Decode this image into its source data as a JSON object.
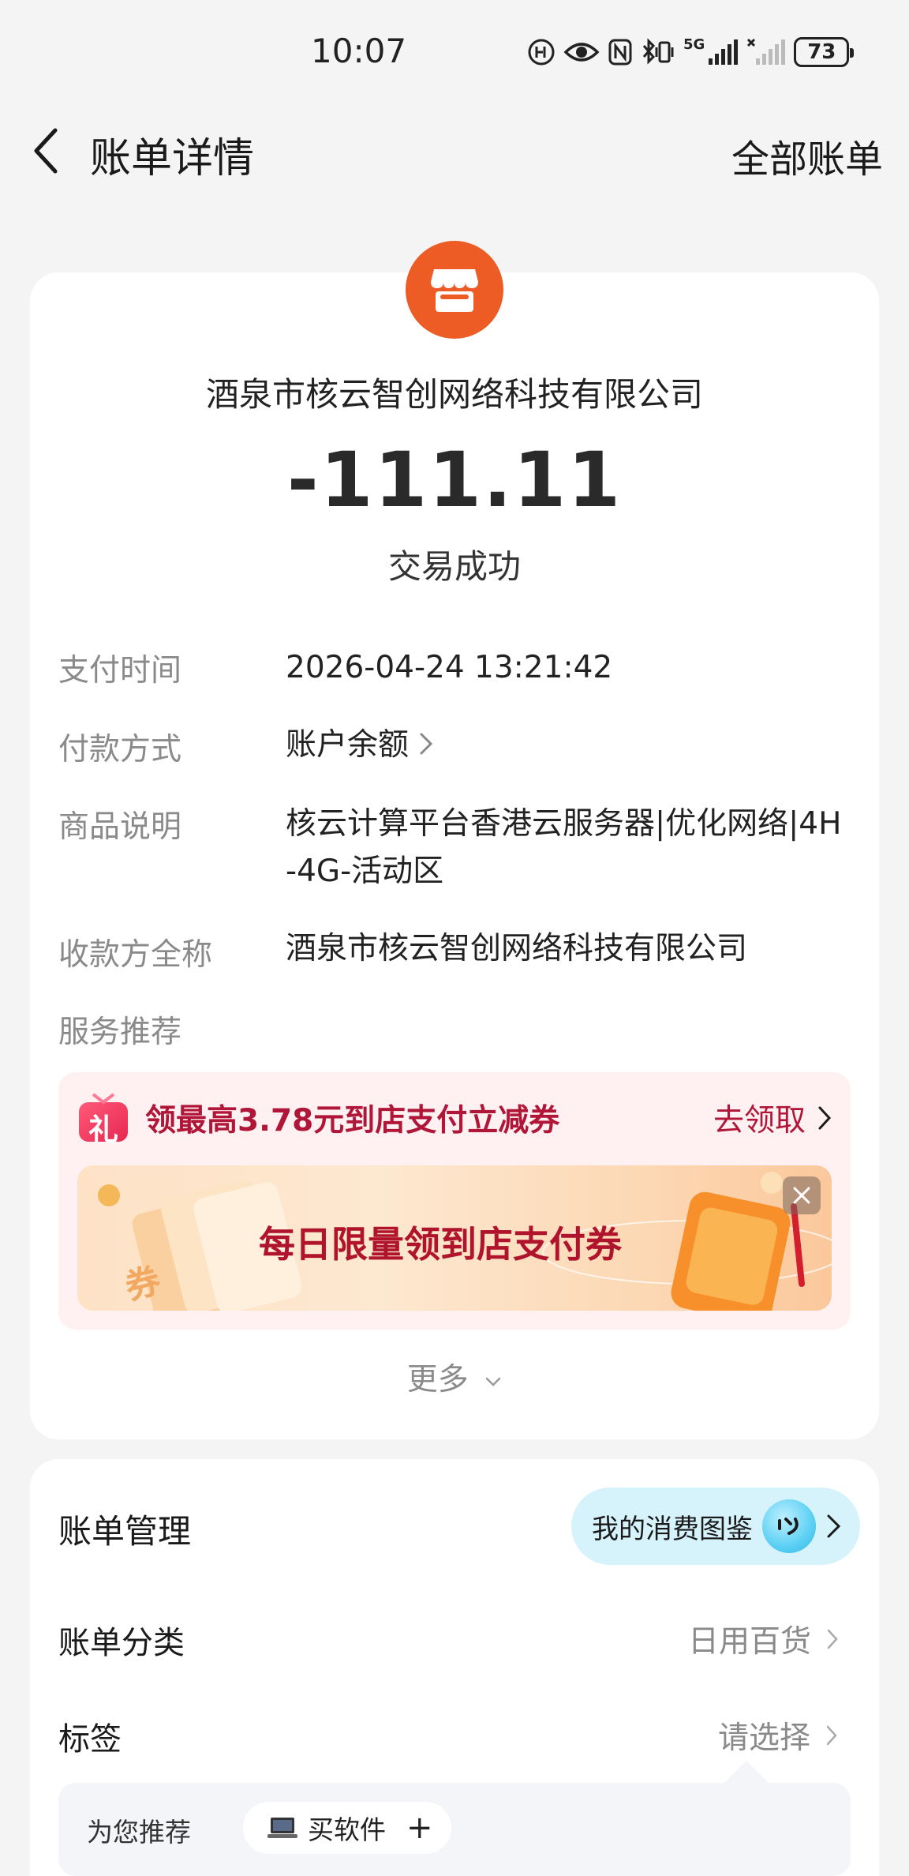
{
  "status_bar": {
    "time": "10:07",
    "network": "5G",
    "battery": "73",
    "icons": [
      "hd-icon",
      "eye-icon",
      "nfc-icon",
      "bluetooth-vibrate-icon",
      "signal-icon",
      "signal-off-icon",
      "battery-icon"
    ]
  },
  "nav": {
    "title": "账单详情",
    "all_bills": "全部账单",
    "back_icon": "chevron-left-icon"
  },
  "summary": {
    "merchant_icon": "shop-icon",
    "merchant_name": "酒泉市核云智创网络科技有限公司",
    "amount": "-111.11",
    "status": "交易成功"
  },
  "details": {
    "pay_time_label": "支付时间",
    "pay_time_value": "2026-04-24 13:21:42",
    "pay_method_label": "付款方式",
    "pay_method_value": "账户余额",
    "product_label": "商品说明",
    "product_value_line1": "核云计算平台香港云服务器|优化网络|4H",
    "product_value_line2": "-4G-活动区",
    "payee_label": "收款方全称",
    "payee_value": "酒泉市核云智创网络科技有限公司",
    "service_label": "服务推荐"
  },
  "coupon": {
    "text": "领最高3.78元到店支付立减券",
    "claim": "去领取",
    "gift_icon_text": "礼",
    "banner_text": "每日限量领到店支付券",
    "banner_coupon_text": "券"
  },
  "more": "更多",
  "management": {
    "title": "账单管理",
    "atlas_button": "我的消费图鉴",
    "category_label": "账单分类",
    "category_value": "日用百货",
    "tag_label": "标签",
    "tag_value": "请选择",
    "recommend_label": "为您推荐",
    "recommend_chip": "买软件",
    "recommend_plus": "+"
  },
  "colors": {
    "merchant_logo": "#ec5c24",
    "coupon_red": "#b01638",
    "atlas_bg": "#d6f3fb"
  }
}
